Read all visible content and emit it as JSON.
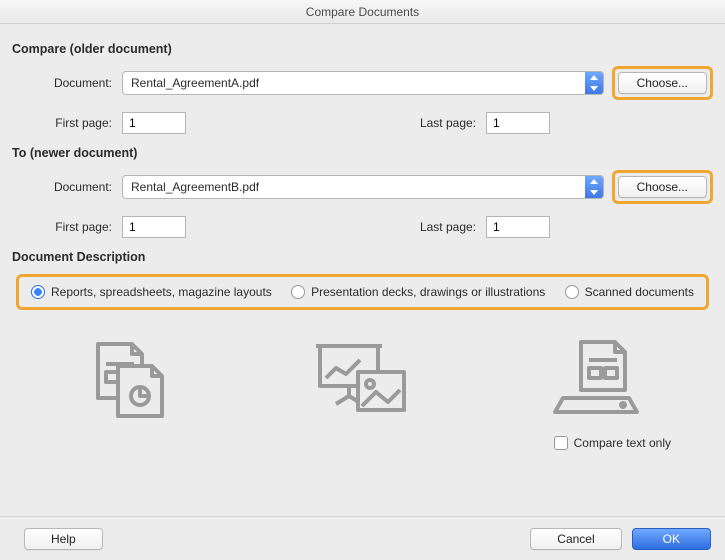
{
  "title": "Compare Documents",
  "older": {
    "heading": "Compare (older document)",
    "document_label": "Document:",
    "document_value": "Rental_AgreementA.pdf",
    "choose_label": "Choose...",
    "first_page_label": "First page:",
    "first_page_value": "1",
    "last_page_label": "Last page:",
    "last_page_value": "1"
  },
  "newer": {
    "heading": "To (newer document)",
    "document_label": "Document:",
    "document_value": "Rental_AgreementB.pdf",
    "choose_label": "Choose...",
    "first_page_label": "First page:",
    "first_page_value": "1",
    "last_page_label": "Last page:",
    "last_page_value": "1"
  },
  "description": {
    "heading": "Document Description",
    "options": {
      "reports": "Reports, spreadsheets, magazine layouts",
      "decks": "Presentation decks, drawings or illustrations",
      "scanned": "Scanned documents"
    },
    "selected": "reports"
  },
  "compare_text_only_label": "Compare text only",
  "footer": {
    "help": "Help",
    "cancel": "Cancel",
    "ok": "OK"
  }
}
